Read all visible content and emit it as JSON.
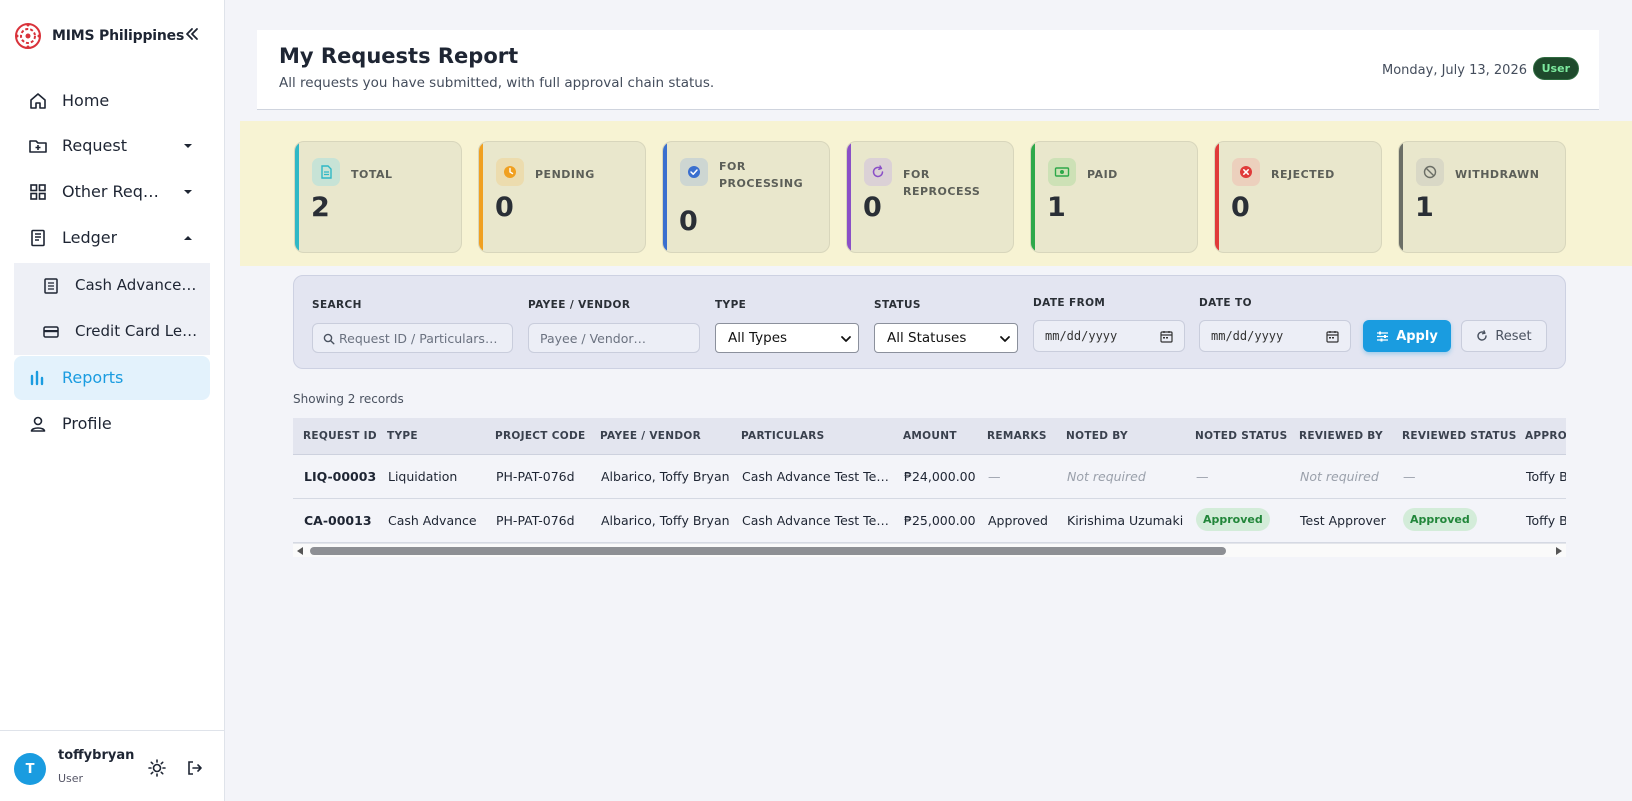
{
  "sidebar": {
    "brand": "MIMS Philippines",
    "nav": {
      "home": "Home",
      "request": "Request",
      "other_requests": "Other Requests",
      "ledger": "Ledger",
      "cash_advance_ledger": "Cash Advance Ledger",
      "credit_card_ledger": "Credit Card Ledger",
      "reports": "Reports",
      "profile": "Profile"
    },
    "user": {
      "name": "toffybryan",
      "initial": "T",
      "role": "User"
    }
  },
  "header": {
    "title": "My Requests Report",
    "subtitle": "All requests you have submitted, with full approval chain status.",
    "date": "Monday, July 13, 2026",
    "role_badge": "User"
  },
  "stats": [
    {
      "label": "TOTAL",
      "value": "2",
      "color": "#2fb8c6",
      "icon": "document-icon"
    },
    {
      "label": "PENDING",
      "value": "0",
      "color": "#f0a020",
      "icon": "clock-icon"
    },
    {
      "label": "FOR PROCESSING",
      "value": "0",
      "color": "#3a6fcf",
      "icon": "check-circle-icon"
    },
    {
      "label": "FOR REPROCESS",
      "value": "0",
      "color": "#8a4fc7",
      "icon": "refresh-icon"
    },
    {
      "label": "PAID",
      "value": "1",
      "color": "#2ea84a",
      "icon": "money-icon"
    },
    {
      "label": "REJECTED",
      "value": "0",
      "color": "#e03a3a",
      "icon": "x-circle-icon"
    },
    {
      "label": "WITHDRAWN",
      "value": "1",
      "color": "#6b6e66",
      "icon": "ban-icon"
    }
  ],
  "filters": {
    "search_label": "SEARCH",
    "search_placeholder": "Request ID / Particulars…",
    "payee_label": "PAYEE / VENDOR",
    "payee_placeholder": "Payee / Vendor…",
    "type_label": "TYPE",
    "type_value": "All Types",
    "status_label": "STATUS",
    "status_value": "All Statuses",
    "date_from_label": "DATE FROM",
    "date_from_placeholder": "mm/dd/yyyy",
    "date_to_label": "DATE TO",
    "date_to_placeholder": "mm/dd/yyyy",
    "apply": "Apply",
    "reset": "Reset"
  },
  "table": {
    "showing": "Showing 2 records",
    "columns": [
      "REQUEST ID",
      "TYPE",
      "PROJECT CODE",
      "PAYEE / VENDOR",
      "PARTICULARS",
      "AMOUNT",
      "REMARKS",
      "NOTED BY",
      "NOTED STATUS",
      "REVIEWED BY",
      "REVIEWED STATUS",
      "APPROVED BY"
    ],
    "rows": [
      {
        "request_id": "LIQ-00003",
        "type": "Liquidation",
        "project_code": "PH-PAT-076d",
        "payee": "Albarico, Toffy Bryan",
        "particulars": "Cash Advance Test Te…",
        "amount": "₱24,000.00",
        "remarks": "—",
        "noted_by": "Not required",
        "noted_status": "—",
        "reviewed_by": "Not required",
        "reviewed_status": "—",
        "approved_by": "Toffy B"
      },
      {
        "request_id": "CA-00013",
        "type": "Cash Advance",
        "project_code": "PH-PAT-076d",
        "payee": "Albarico, Toffy Bryan",
        "particulars": "Cash Advance Test Te…",
        "amount": "₱25,000.00",
        "remarks": "Approved",
        "noted_by": "Kirishima Uzumaki",
        "noted_status": "Approved",
        "reviewed_by": "Test Approver",
        "reviewed_status": "Approved",
        "approved_by": "Toffy B"
      }
    ]
  }
}
